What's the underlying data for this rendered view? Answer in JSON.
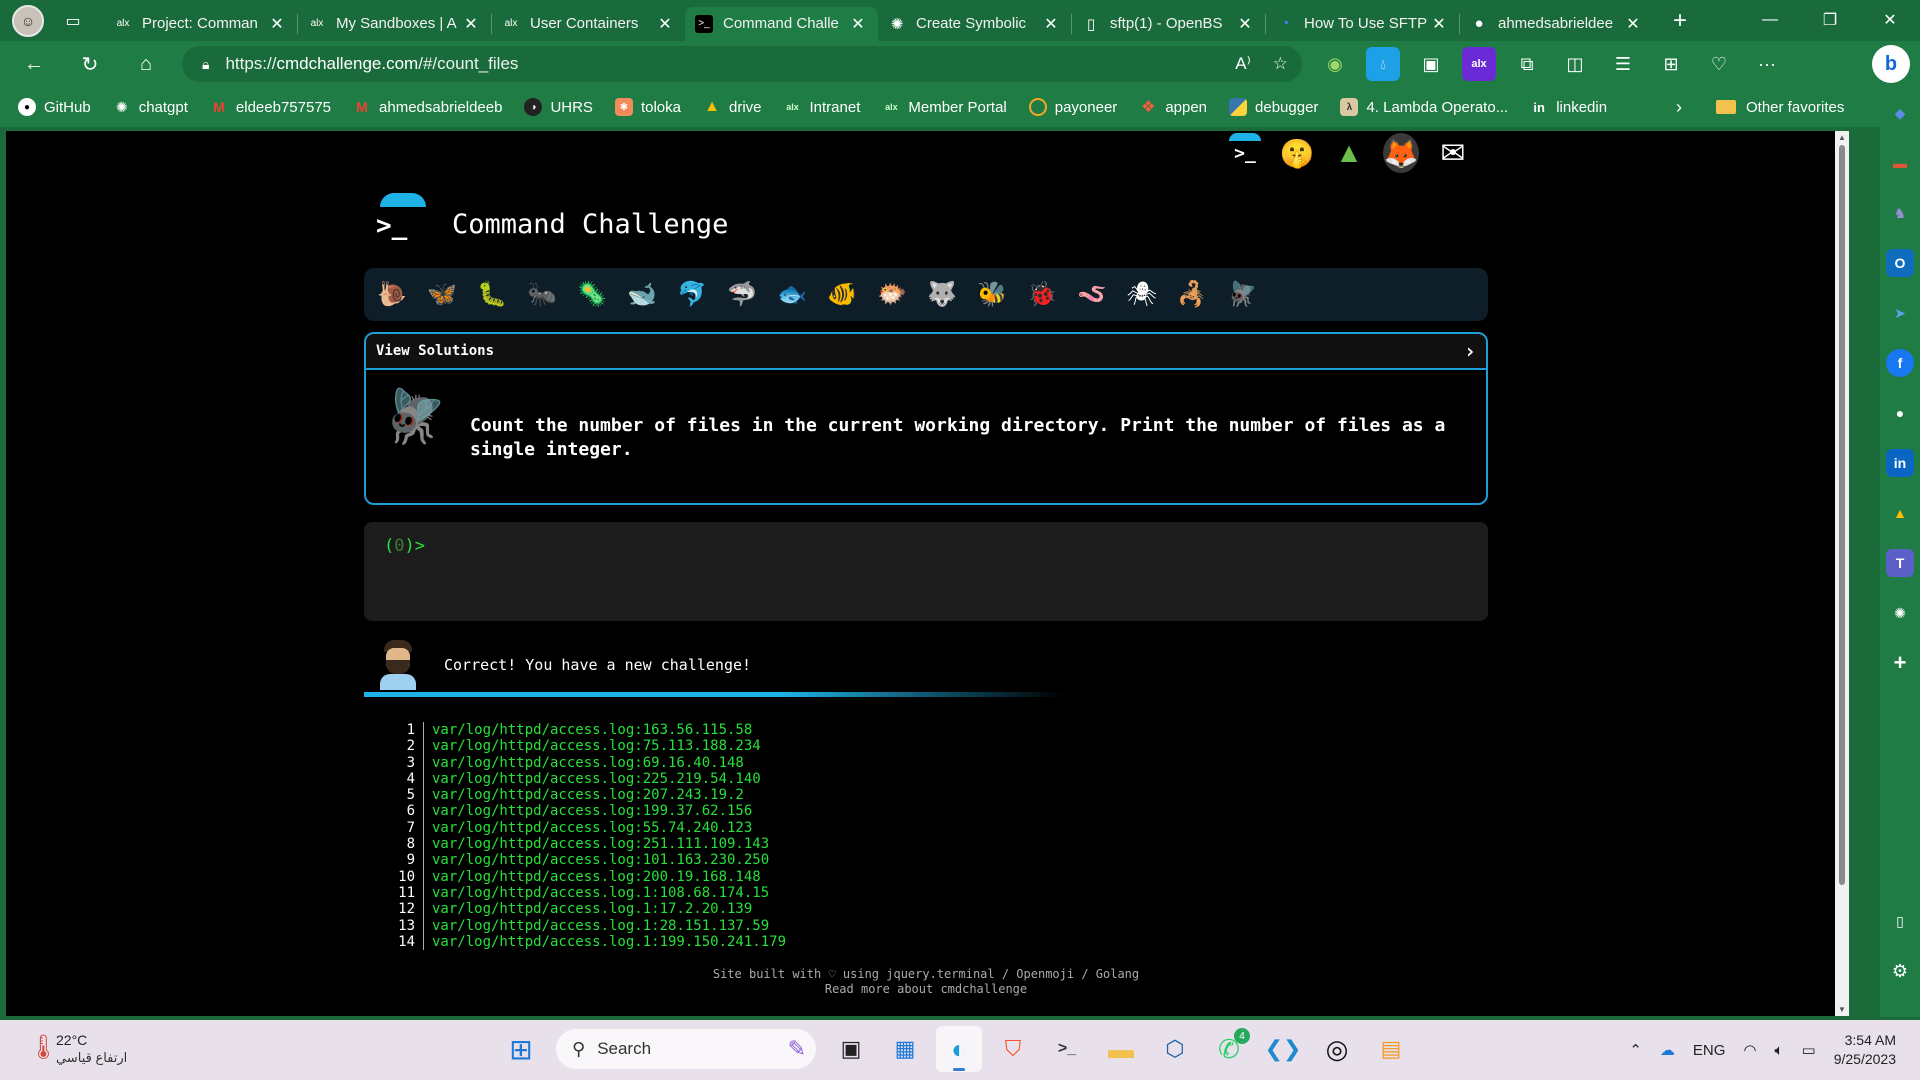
{
  "browser": {
    "tabs": [
      {
        "title": "Project: Comman",
        "favicon": "alx-icon",
        "active": false
      },
      {
        "title": "My Sandboxes | A",
        "favicon": "alx-icon",
        "active": false
      },
      {
        "title": "User Containers",
        "favicon": "alx-icon",
        "active": false
      },
      {
        "title": "Command Challe",
        "favicon": "terminal-icon",
        "active": true
      },
      {
        "title": "Create Symbolic",
        "favicon": "chatgpt-icon",
        "active": false
      },
      {
        "title": "sftp(1) - OpenBS",
        "favicon": "document-icon",
        "active": false
      },
      {
        "title": "How To Use SFTP",
        "favicon": "digitalocean-icon",
        "active": false
      },
      {
        "title": "ahmedsabrieldee",
        "favicon": "github-icon",
        "active": false
      }
    ],
    "url_prefix": "https://",
    "url_host": "cmdchallenge.com",
    "url_path": "/#/count_files",
    "favorites": [
      {
        "label": "GitHub",
        "icon": "github-icon"
      },
      {
        "label": "chatgpt",
        "icon": "chatgpt-icon"
      },
      {
        "label": "eldeeb757575",
        "icon": "gmail-icon"
      },
      {
        "label": "ahmedsabrieldeeb",
        "icon": "gmail-icon"
      },
      {
        "label": "UHRS",
        "icon": "uhrs-icon"
      },
      {
        "label": "toloka",
        "icon": "toloka-icon"
      },
      {
        "label": "drive",
        "icon": "drive-icon"
      },
      {
        "label": "Intranet",
        "icon": "alx-icon"
      },
      {
        "label": "Member Portal",
        "icon": "alx-icon"
      },
      {
        "label": "payoneer",
        "icon": "payoneer-icon"
      },
      {
        "label": "appen",
        "icon": "appen-icon"
      },
      {
        "label": "debugger",
        "icon": "python-icon"
      },
      {
        "label": "4. Lambda Operato...",
        "icon": "lambda-icon"
      },
      {
        "label": "linkedin",
        "icon": "linkedin-icon"
      }
    ],
    "other_favorites": "Other favorites"
  },
  "page": {
    "site_title": "Command Challenge",
    "view_solutions": "View Solutions",
    "challenge_text": "Count the number of files in the current working directory. Print the number of files as a single integer.",
    "prompt_open": "(",
    "prompt_num": "0",
    "prompt_close": ")>",
    "result_msg": "Correct! You have a new challenge!",
    "output_lines": [
      {
        "n": "1",
        "text": "var/log/httpd/access.log:163.56.115.58"
      },
      {
        "n": "2",
        "text": "var/log/httpd/access.log:75.113.188.234"
      },
      {
        "n": "3",
        "text": "var/log/httpd/access.log:69.16.40.148"
      },
      {
        "n": "4",
        "text": "var/log/httpd/access.log:225.219.54.140"
      },
      {
        "n": "5",
        "text": "var/log/httpd/access.log:207.243.19.2"
      },
      {
        "n": "6",
        "text": "var/log/httpd/access.log:199.37.62.156"
      },
      {
        "n": "7",
        "text": "var/log/httpd/access.log:55.74.240.123"
      },
      {
        "n": "8",
        "text": "var/log/httpd/access.log:251.111.109.143"
      },
      {
        "n": "9",
        "text": "var/log/httpd/access.log:101.163.230.250"
      },
      {
        "n": "10",
        "text": "var/log/httpd/access.log:200.19.168.148"
      },
      {
        "n": "11",
        "text": "var/log/httpd/access.log.1:108.68.174.15"
      },
      {
        "n": "12",
        "text": "var/log/httpd/access.log.1:17.2.20.139"
      },
      {
        "n": "13",
        "text": "var/log/httpd/access.log.1:28.151.137.59"
      },
      {
        "n": "14",
        "text": "var/log/httpd/access.log.1:199.150.241.179"
      }
    ],
    "footer_line1": "Site built with ♡ using jquery.terminal / Openmoji / Golang",
    "footer_line2": "Read more about cmdchallenge"
  },
  "taskbar": {
    "temperature": "22°C",
    "weather_text": "ارتفاع قياسي",
    "search_placeholder": "Search",
    "whatsapp_badge": "4",
    "language": "ENG",
    "time": "3:54 AM",
    "date": "9/25/2023"
  },
  "colors": {
    "browser_green": "#1f7c45",
    "accent_blue": "#1c9fd6",
    "terminal_green": "#27e03b"
  }
}
